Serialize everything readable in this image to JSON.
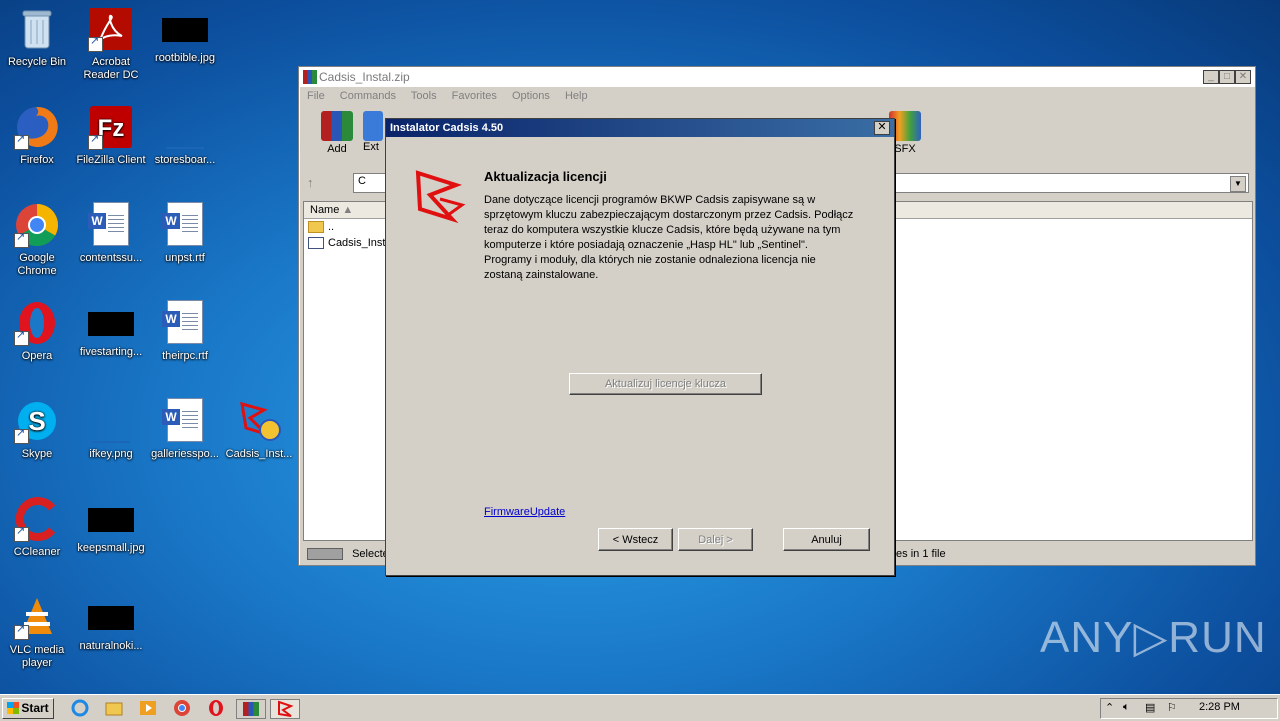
{
  "desktop": {
    "icons": [
      {
        "label": "Recycle Bin"
      },
      {
        "label": "Acrobat\nReader DC"
      },
      {
        "label": "rootbible.jpg"
      },
      {
        "label": "Firefox"
      },
      {
        "label": "FileZilla Client"
      },
      {
        "label": "storesboar..."
      },
      {
        "label": "Google\nChrome"
      },
      {
        "label": "contentssu..."
      },
      {
        "label": "unpst.rtf"
      },
      {
        "label": "Opera"
      },
      {
        "label": "fivestarting..."
      },
      {
        "label": "theirpc.rtf"
      },
      {
        "label": "Skype"
      },
      {
        "label": "ifkey.png"
      },
      {
        "label": "galleriesspo..."
      },
      {
        "label": "Cadsis_Inst..."
      },
      {
        "label": "CCleaner"
      },
      {
        "label": "keepsmall.jpg"
      },
      {
        "label": "VLC media\nplayer"
      },
      {
        "label": "naturalnoki..."
      }
    ]
  },
  "rar_window": {
    "title": "Cadsis_Instal.zip",
    "menu": [
      "File",
      "Commands",
      "Tools",
      "Favorites",
      "Options",
      "Help"
    ],
    "tools": {
      "add": "Add",
      "extract": "Ext",
      "sfx": "SFX"
    },
    "address_text": "C",
    "list_header": "Name",
    "rows": [
      "..",
      "Cadsis_Insta"
    ],
    "status_left": "Selected",
    "status_right": "tes in 1 file"
  },
  "dialog": {
    "title": "Instalator Cadsis 4.50",
    "heading": "Aktualizacja licencji",
    "body": "Dane dotyczące licencji programów BKWP Cadsis zapisywane są w sprzętowym kluczu zabezpieczającym dostarczonym przez Cadsis. Podłącz teraz do komputera wszystkie klucze Cadsis, które będą używane na tym komputerze i które posiadają oznaczenie „Hasp HL\" lub „Sentinel\". Programy i moduły, dla których nie zostanie odnaleziona licencja nie zostaną zainstalowane.",
    "update_button": "Aktualizuj licencje klucza",
    "firmware_link": "FirmwareUpdate",
    "back_button": "< Wstecz",
    "next_button": "Dalej >",
    "cancel_button": "Anuluj"
  },
  "taskbar": {
    "start_label": "Start",
    "clock": "2:28 PM"
  },
  "watermark": "ANY▷RUN"
}
